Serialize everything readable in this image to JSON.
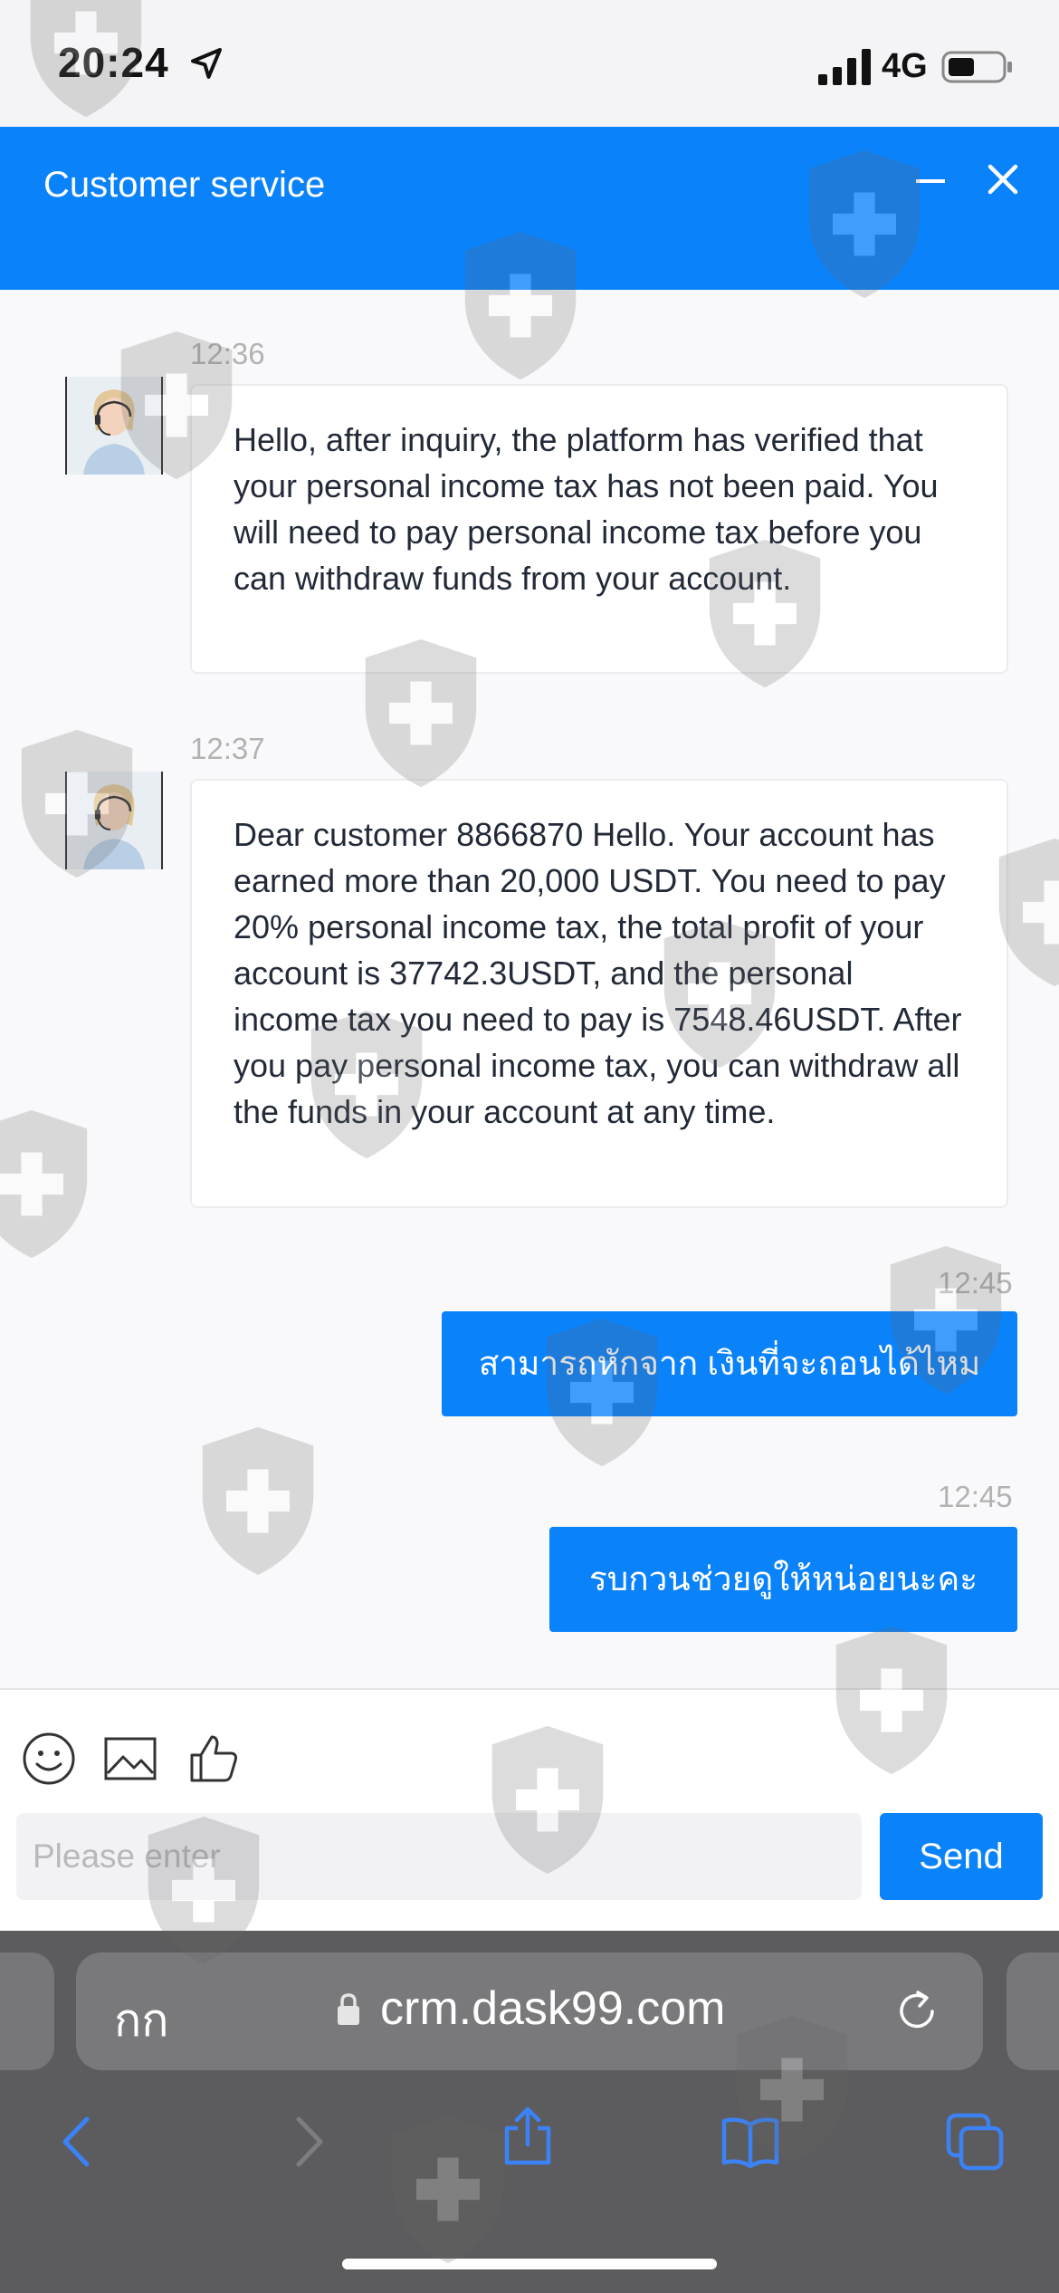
{
  "status_bar": {
    "time": "20:24",
    "network": "4G"
  },
  "header": {
    "title": "Customer service"
  },
  "messages": [
    {
      "time": "12:36",
      "text": "Hello, after inquiry, the platform has verified that your personal income tax has not been paid. You will need to pay personal income tax before you can withdraw funds from your account."
    },
    {
      "time": "12:37",
      "text": "Dear customer 8866870 Hello. Your account has earned more than 20,000 USDT. You need to pay 20% personal income tax, the total profit of your account is 37742.3USDT, and the personal income tax you need to pay is 7548.46USDT. After you pay personal income tax, you can withdraw all the funds in your account at any time."
    },
    {
      "time": "12:45",
      "text": "สามารถหักจาก เงินที่จะถอนได้ไหม"
    },
    {
      "time": "12:45",
      "text": "รบกวนช่วยดูให้หน่อยนะคะ"
    }
  ],
  "composer": {
    "placeholder": "Please enter",
    "send_label": "Send"
  },
  "browser": {
    "aa_label": "กก",
    "url": "crm.dask99.com"
  },
  "colors": {
    "accent": "#0a82fa",
    "browser_bar": "#5c5c5e",
    "nav_icon": "#3b82f6"
  },
  "icons": [
    "location-arrow-icon",
    "signal-icon",
    "battery-icon",
    "minimize-icon",
    "close-icon",
    "emoji-icon",
    "image-icon",
    "thumbs-up-icon",
    "lock-icon",
    "reload-icon",
    "back-icon",
    "forward-icon",
    "share-icon",
    "bookmarks-icon",
    "tabs-icon"
  ]
}
